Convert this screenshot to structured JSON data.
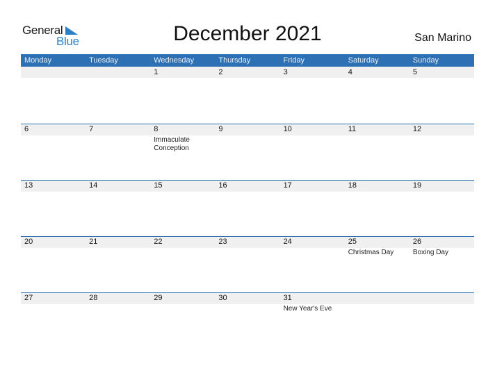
{
  "logo": {
    "line1": "General",
    "line2": "Blue"
  },
  "title": "December 2021",
  "country": "San Marino",
  "weekdays": [
    "Monday",
    "Tuesday",
    "Wednesday",
    "Thursday",
    "Friday",
    "Saturday",
    "Sunday"
  ],
  "weeks": [
    [
      {
        "day": ""
      },
      {
        "day": ""
      },
      {
        "day": "1"
      },
      {
        "day": "2"
      },
      {
        "day": "3"
      },
      {
        "day": "4"
      },
      {
        "day": "5"
      }
    ],
    [
      {
        "day": "6"
      },
      {
        "day": "7"
      },
      {
        "day": "8",
        "event": "Immaculate Conception"
      },
      {
        "day": "9"
      },
      {
        "day": "10"
      },
      {
        "day": "11"
      },
      {
        "day": "12"
      }
    ],
    [
      {
        "day": "13"
      },
      {
        "day": "14"
      },
      {
        "day": "15"
      },
      {
        "day": "16"
      },
      {
        "day": "17"
      },
      {
        "day": "18"
      },
      {
        "day": "19"
      }
    ],
    [
      {
        "day": "20"
      },
      {
        "day": "21"
      },
      {
        "day": "22"
      },
      {
        "day": "23"
      },
      {
        "day": "24"
      },
      {
        "day": "25",
        "event": "Christmas Day"
      },
      {
        "day": "26",
        "event": "Boxing Day"
      }
    ],
    [
      {
        "day": "27"
      },
      {
        "day": "28"
      },
      {
        "day": "29"
      },
      {
        "day": "30"
      },
      {
        "day": "31",
        "event": "New Year's Eve"
      },
      {
        "day": ""
      },
      {
        "day": ""
      }
    ]
  ],
  "colors": {
    "header_bg": "#2d71b4",
    "brand_blue": "#2a7fc9",
    "date_row_bg": "#f0f0f0"
  }
}
